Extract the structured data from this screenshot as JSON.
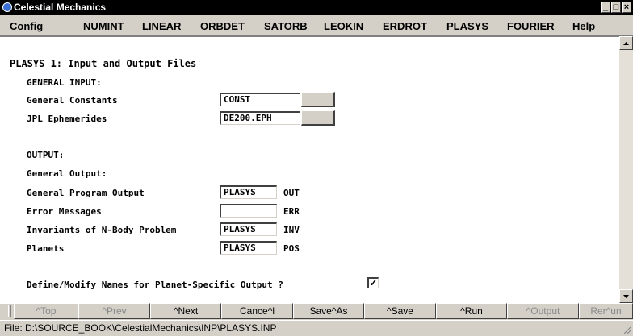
{
  "window": {
    "title": "Celestial Mechanics",
    "controls": [
      "_",
      "□",
      "×"
    ]
  },
  "menu": [
    "Config",
    "NUMINT",
    "LINEAR",
    "ORBDET",
    "SATORB",
    "LEOKIN",
    "ERDROT",
    "PLASYS",
    "FOURIER",
    "Help"
  ],
  "form": {
    "heading": "PLASYS 1: Input and Output Files",
    "general_input_label": "GENERAL INPUT:",
    "general_constants": {
      "label": "General Constants",
      "value": "CONST"
    },
    "jpl_ephemerides": {
      "label": "JPL Ephemerides",
      "value": "DE200.EPH"
    },
    "output_label": "OUTPUT:",
    "general_output_label": "General Output:",
    "general_program_output": {
      "label": "General Program Output",
      "value": "PLASYS",
      "ext": "OUT"
    },
    "error_messages": {
      "label": "Error Messages",
      "value": "",
      "ext": "ERR"
    },
    "invariants": {
      "label": "Invariants of N-Body Problem",
      "value": "PLASYS",
      "ext": "INV"
    },
    "planets": {
      "label": "Planets",
      "value": "PLASYS",
      "ext": "POS"
    },
    "define_names": {
      "label": "Define/Modify Names for Planet-Specific Output ?",
      "checked": true,
      "mark": "✓"
    }
  },
  "buttons": [
    {
      "label": "^Top",
      "enabled": false
    },
    {
      "label": "^Prev",
      "enabled": false
    },
    {
      "label": "^Next",
      "enabled": true
    },
    {
      "label": "Cance^l",
      "enabled": true
    },
    {
      "label": "Save^As",
      "enabled": true
    },
    {
      "label": "^Save",
      "enabled": true
    },
    {
      "label": "^Run",
      "enabled": true
    },
    {
      "label": "^Output",
      "enabled": false
    },
    {
      "label": "Rer^un",
      "enabled": false
    }
  ],
  "status": {
    "file": "File: D:\\SOURCE_BOOK\\CelestialMechanics\\INP\\PLASYS.INP"
  }
}
